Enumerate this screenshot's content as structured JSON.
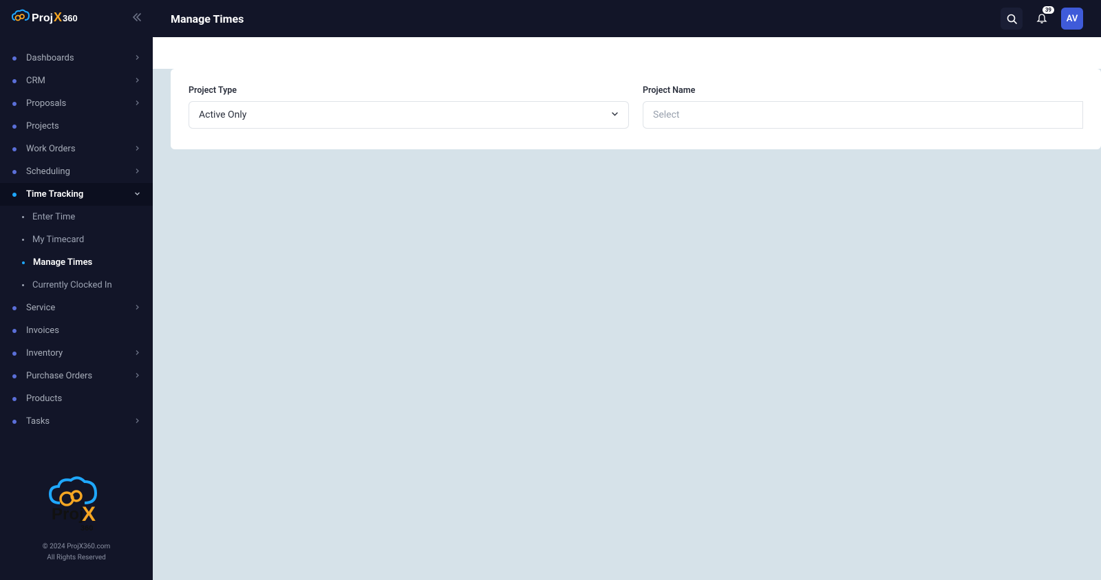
{
  "brand": "ProjX360",
  "header": {
    "title": "Manage Times",
    "notification_count": "39",
    "avatar_initials": "AV"
  },
  "sidebar": {
    "items": [
      {
        "label": "Dashboards",
        "expandable": true
      },
      {
        "label": "CRM",
        "expandable": true
      },
      {
        "label": "Proposals",
        "expandable": true
      },
      {
        "label": "Projects",
        "expandable": false
      },
      {
        "label": "Work Orders",
        "expandable": true
      },
      {
        "label": "Scheduling",
        "expandable": true
      },
      {
        "label": "Time Tracking",
        "expandable": true,
        "active": true,
        "expanded": true,
        "children": [
          {
            "label": "Enter Time"
          },
          {
            "label": "My Timecard"
          },
          {
            "label": "Manage Times",
            "active": true
          },
          {
            "label": "Currently Clocked In"
          }
        ]
      },
      {
        "label": "Service",
        "expandable": true
      },
      {
        "label": "Invoices",
        "expandable": false
      },
      {
        "label": "Inventory",
        "expandable": true
      },
      {
        "label": "Purchase Orders",
        "expandable": true
      },
      {
        "label": "Products",
        "expandable": false
      },
      {
        "label": "Tasks",
        "expandable": true
      }
    ],
    "footer_line1": "© 2024 ProjX360.com",
    "footer_line2": "All Rights Reserved"
  },
  "filters": {
    "project_type": {
      "label": "Project Type",
      "value": "Active Only"
    },
    "project_name": {
      "label": "Project Name",
      "placeholder": "Select"
    }
  }
}
